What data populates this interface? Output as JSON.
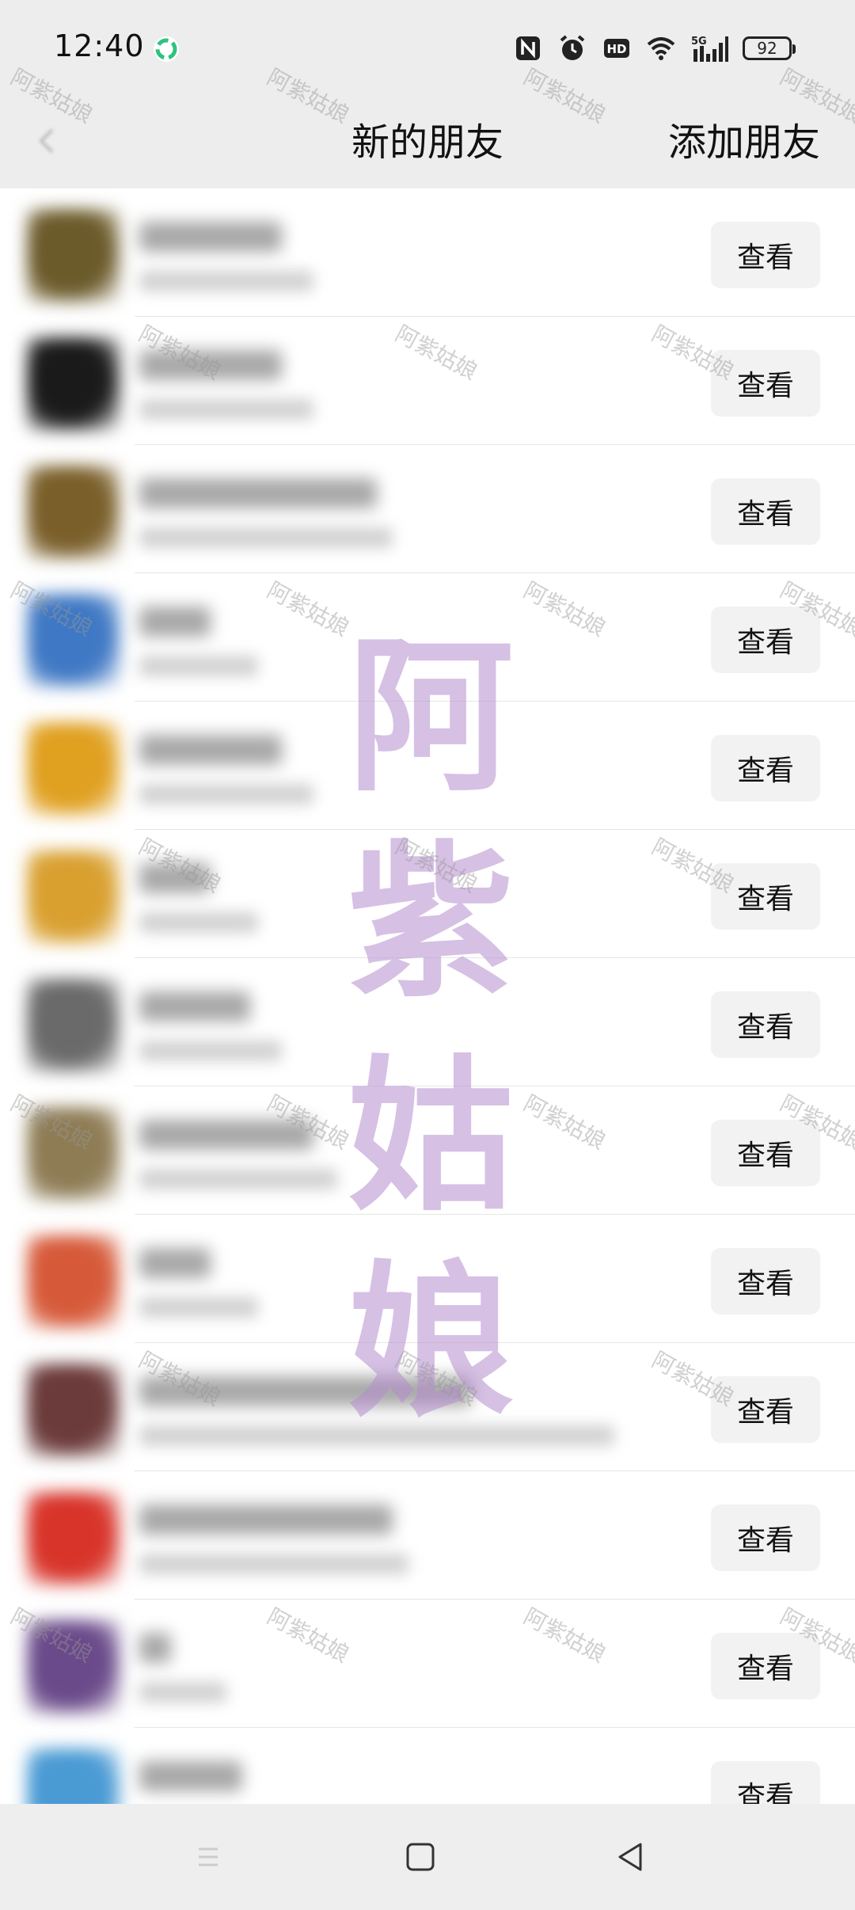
{
  "status_bar": {
    "time": "12:40",
    "network_label": "5G",
    "hd_label": "HD",
    "battery": "92"
  },
  "header": {
    "title": "新的朋友",
    "add_friend_label": "添加朋友"
  },
  "list": {
    "view_label": "查看",
    "rows": [
      {
        "avatar_color": "#6b5a2a"
      },
      {
        "avatar_color": "#1a1a1a"
      },
      {
        "avatar_color": "#7a5f2a"
      },
      {
        "avatar_color": "#3f78c4"
      },
      {
        "avatar_color": "#e0a020"
      },
      {
        "avatar_color": "#d9a030"
      },
      {
        "avatar_color": "#6a6a6a"
      },
      {
        "avatar_color": "#8e7c55"
      },
      {
        "avatar_color": "#d65a3a"
      },
      {
        "avatar_color": "#6b3a3a"
      },
      {
        "avatar_color": "#d8342a"
      },
      {
        "avatar_color": "#6a4a8a"
      },
      {
        "avatar_color": "#4a9ad4"
      }
    ]
  },
  "watermark": {
    "small_text": "阿紫姑娘",
    "big_chars": [
      "阿",
      "紫",
      "姑",
      "娘"
    ]
  }
}
